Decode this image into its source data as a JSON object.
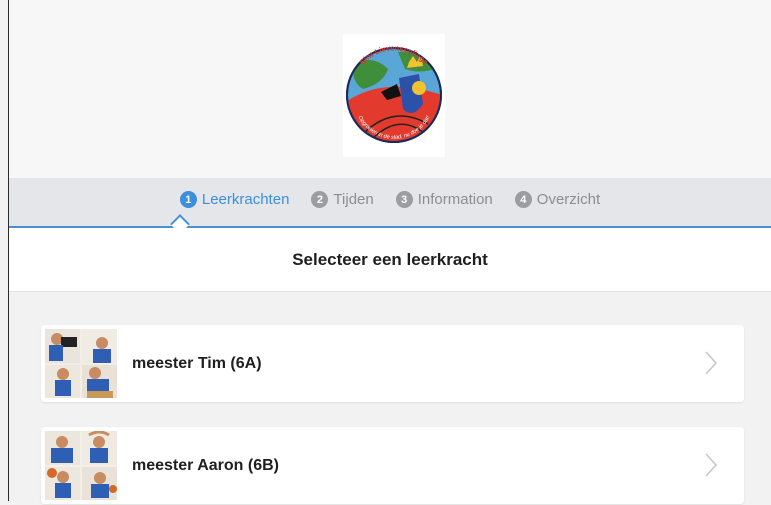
{
  "header": {
    "logo_top_text": "Sint-Lievenscollege",
    "logo_bottom_text": "Opgroeien in de stad, nu doe je dat!"
  },
  "steps": [
    {
      "num": "1",
      "label": "Leerkrachten",
      "active": true
    },
    {
      "num": "2",
      "label": "Tijden",
      "active": false
    },
    {
      "num": "3",
      "label": "Information",
      "active": false
    },
    {
      "num": "4",
      "label": "Overzicht",
      "active": false
    }
  ],
  "page_title": "Selecteer een leerkracht",
  "teachers": [
    {
      "name": "meester Tim (6A)"
    },
    {
      "name": "meester Aaron (6B)"
    }
  ],
  "colors": {
    "accent": "#3b8fdc"
  }
}
